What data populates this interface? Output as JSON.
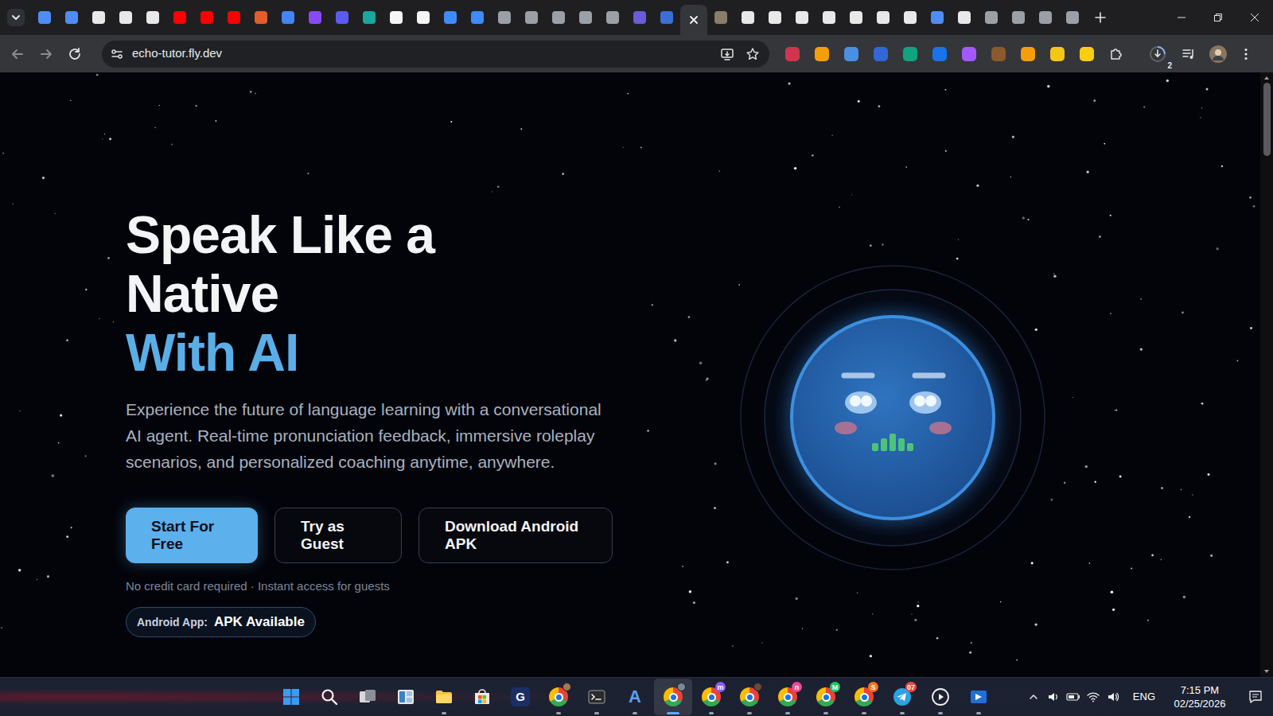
{
  "browser": {
    "tabs": [
      {
        "selected": false,
        "color": "#4f8df5"
      },
      {
        "selected": false,
        "color": "#4f8df5"
      },
      {
        "selected": false,
        "color": "#e8e8e8"
      },
      {
        "selected": false,
        "color": "#e8e8e8"
      },
      {
        "selected": false,
        "color": "#e8e8e8"
      },
      {
        "selected": false,
        "color": "#ff0000"
      },
      {
        "selected": false,
        "color": "#ff0000"
      },
      {
        "selected": false,
        "color": "#ff0000"
      },
      {
        "selected": false,
        "color": "#e25d2a"
      },
      {
        "selected": false,
        "color": "#4285f4"
      },
      {
        "selected": false,
        "color": "#8a4af3"
      },
      {
        "selected": false,
        "color": "#5b5bf0"
      },
      {
        "selected": false,
        "color": "#19a89d"
      },
      {
        "selected": false,
        "color": "#f5f5f5"
      },
      {
        "selected": false,
        "color": "#f5f5f5"
      },
      {
        "selected": false,
        "color": "#3d8bfd"
      },
      {
        "selected": false,
        "color": "#3d8bfd"
      },
      {
        "selected": false,
        "color": "#9aa0a6"
      },
      {
        "selected": false,
        "color": "#9aa0a6"
      },
      {
        "selected": false,
        "color": "#9aa0a6"
      },
      {
        "selected": false,
        "color": "#9aa0a6"
      },
      {
        "selected": false,
        "color": "#9aa0a6"
      },
      {
        "selected": false,
        "color": "#6b5bd6"
      },
      {
        "selected": false,
        "color": "#3b6fd6"
      },
      {
        "selected": true
      },
      {
        "selected": false,
        "color": "#8a7d6a"
      },
      {
        "selected": false,
        "color": "#e8e8e8"
      },
      {
        "selected": false,
        "color": "#e8e8e8"
      },
      {
        "selected": false,
        "color": "#e8e8e8"
      },
      {
        "selected": false,
        "color": "#e8e8e8"
      },
      {
        "selected": false,
        "color": "#e8e8e8"
      },
      {
        "selected": false,
        "color": "#e8e8e8"
      },
      {
        "selected": false,
        "color": "#e8e8e8"
      },
      {
        "selected": false,
        "color": "#4f8df5"
      },
      {
        "selected": false,
        "color": "#e8e8e8"
      },
      {
        "selected": false,
        "color": "#9aa0a6"
      },
      {
        "selected": false,
        "color": "#9aa0a6"
      },
      {
        "selected": false,
        "color": "#9aa0a6"
      },
      {
        "selected": false,
        "color": "#9aa0a6"
      }
    ],
    "address": "echo-tutor.fly.dev",
    "extensions": [
      {
        "color": "#d1344f"
      },
      {
        "color": "#f59e0b"
      },
      {
        "color": "#4a90e2"
      },
      {
        "color": "#3367d6"
      },
      {
        "color": "#10a37f"
      },
      {
        "color": "#1a73e8"
      },
      {
        "color": "#a259ff"
      },
      {
        "color": "#8b5a2b"
      },
      {
        "color": "#f59e0b"
      },
      {
        "color": "#f5c518"
      },
      {
        "color": "#facc15"
      }
    ],
    "downloads_count": "2"
  },
  "hero": {
    "title_lines": [
      "Speak Like a",
      "Native"
    ],
    "title_accent": "With AI",
    "description": "Experience the future of language learning with a conversational AI agent. Real-time pronunciation feedback, immersive roleplay scenarios, and personalized coaching anytime, anywhere.",
    "buttons": [
      {
        "label": "Start For Free",
        "kind": "primary"
      },
      {
        "label": "Try as Guest",
        "kind": "outline"
      },
      {
        "label": "Download Android APK",
        "kind": "outline"
      }
    ],
    "note": "No credit card required · Instant access for guests",
    "badge": {
      "label": "Android App:",
      "value": "APK Available"
    }
  },
  "taskbar": {
    "apps": [
      {
        "kind": "start",
        "selected": false,
        "running": false
      },
      {
        "kind": "search",
        "selected": false,
        "running": false
      },
      {
        "kind": "taskview",
        "selected": false,
        "running": false
      },
      {
        "kind": "widgets",
        "selected": false,
        "running": false
      },
      {
        "kind": "explorer",
        "selected": false,
        "running": true
      },
      {
        "kind": "store",
        "selected": false,
        "running": false
      },
      {
        "kind": "letter",
        "label": "G",
        "selected": false,
        "running": false
      },
      {
        "kind": "chrome",
        "selected": false,
        "running": true,
        "badge": {
          "color": "#a07850"
        }
      },
      {
        "kind": "terminal",
        "selected": false,
        "running": true
      },
      {
        "kind": "arc",
        "label": "A",
        "selected": false,
        "running": true
      },
      {
        "kind": "chrome",
        "selected": true,
        "running": true,
        "badge": {
          "color": "#7a8a9a"
        }
      },
      {
        "kind": "chrome",
        "selected": false,
        "running": true,
        "badge": {
          "text": "m",
          "color": "#8b5cf6"
        }
      },
      {
        "kind": "chrome",
        "selected": false,
        "running": true,
        "badge": {
          "color": "#6b4a3a"
        }
      },
      {
        "kind": "chrome",
        "selected": false,
        "running": true,
        "badge": {
          "text": "n",
          "color": "#ec4899"
        }
      },
      {
        "kind": "chrome",
        "selected": false,
        "running": true,
        "badge": {
          "text": "M",
          "color": "#22c55e"
        }
      },
      {
        "kind": "chrome",
        "selected": false,
        "running": true,
        "badge": {
          "text": "S",
          "color": "#f97316"
        }
      },
      {
        "kind": "telegram",
        "selected": false,
        "running": true,
        "badge": {
          "text": "07",
          "color": "#ef4444"
        }
      },
      {
        "kind": "media",
        "selected": false,
        "running": true
      },
      {
        "kind": "blueapp",
        "selected": false,
        "running": true
      }
    ],
    "language": "ENG",
    "time": "7:15 PM",
    "date": "02/25/2026"
  }
}
